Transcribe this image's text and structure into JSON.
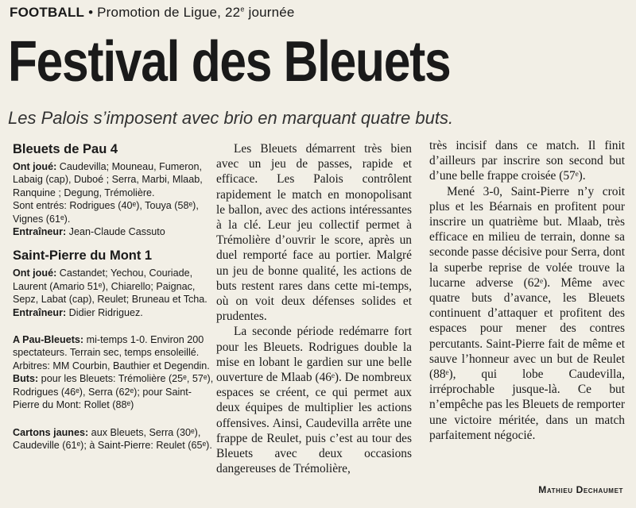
{
  "kicker": {
    "sport": "FOOTBALL",
    "competition": " • Promotion de Ligue, 22",
    "competition_sup": "e",
    "competition_end": " journée"
  },
  "headline": "Festival des Bleuets",
  "subhead": "Les Palois s’imposent avec brio en marquant quatre buts.",
  "sidebar": {
    "team1": {
      "name": "Bleuets de Pau 4",
      "played_label": "Ont joué:",
      "played": " Caudevilla; Mouneau, Fumeron, Labaig (cap), Duboé ; Serra, Marbi, Mlaab, Ranquine ; Degung, Trémolière.",
      "subs": "Sont entrés: Rodrigues (40ᵉ), Touya (58ᵉ), Vignes (61ᵉ).",
      "coach_label": "Entraîneur:",
      "coach": " Jean-Claude Cassuto"
    },
    "team2": {
      "name": "Saint-Pierre du Mont 1",
      "played_label": "Ont joué:",
      "played": " Castandet; Yechou, Couriade, Laurent (Amario 51ᵉ), Chiarello; Paignac, Sepz, Labat (cap), Reulet; Bruneau et Tcha.",
      "coach_label": "Entraîneur:",
      "coach": " Didier Ridriguez."
    },
    "venue_label": "A Pau-Bleuets:",
    "venue": " mi-temps 1-0. Environ 200 spectateurs. Terrain sec, temps ensoleillé. Arbitres: MM Courbin, Bauthier et Degendin.",
    "goals_label": "Buts:",
    "goals": " pour les Bleuets: Trémolière (25ᵉ, 57ᵉ), Rodrigues (46ᵉ), Serra (62ᵉ); pour Saint-Pierre du Mont: Rollet (88ᵉ)",
    "cards_label": "Cartons jaunes:",
    "cards": " aux Bleuets, Serra (30ᵉ), Caudeville (61ᵉ); à Saint-Pierre: Reulet (65ᵉ)."
  },
  "article": {
    "col2": [
      "Les Bleuets démarrent très bien avec un jeu de passes, rapide et efficace. Les Palois contrôlent rapidement le match en monopolisant le ballon, avec des actions intéressantes à la clé. Leur jeu collectif permet à Trémolière d’ouvrir le score, après un duel remporté face au portier. Malgré un jeu de bonne qualité, les actions de buts restent rares dans cette mi-temps, où on voit deux défenses solides et prudentes.",
      "La seconde période redémarre fort pour les Bleuets. Rodrigues double la mise en lobant le gardien sur une belle ouverture de Mlaab (46ᵉ). De nombreux espaces se créent, ce qui permet aux deux équipes de multiplier les actions offensives. Ainsi, Caudevilla arrête une frappe de Reulet, puis c’est au tour des Bleuets avec deux occasions dangereuses de Trémolière,"
    ],
    "col3_cont": "très incisif dans ce match. Il finit d’ailleurs par inscrire son second but d’une belle frappe croisée (57ᵉ).",
    "col3": [
      "Mené 3-0, Saint-Pierre n’y croit plus et les Béarnais en profitent pour inscrire un quatrième but. Mlaab, très efficace en milieu de terrain, donne sa seconde passe décisive pour Serra, dont la superbe reprise de volée trouve la lucarne adverse (62ᵉ). Même avec quatre buts d’avance, les Bleuets continuent d’attaquer et profitent des espaces pour mener des contres percutants. Saint-Pierre fait de même et sauve l’honneur avec un but de Reulet (88ᵉ), qui lobe Caudevilla, irréprochable jusque-là. Ce but n’empêche pas les Bleuets de remporter une victoire méritée, dans un match parfaitement négocié."
    ],
    "author": "Mathieu Dechaumet"
  }
}
